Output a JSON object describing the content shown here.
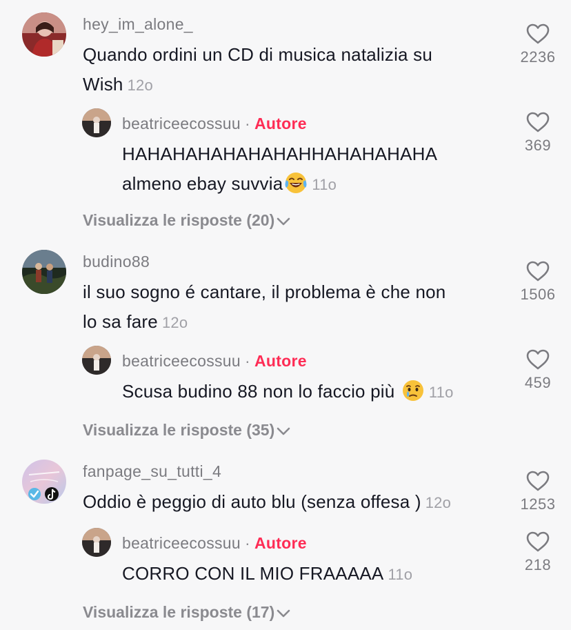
{
  "comments": [
    {
      "username": "hey_im_alone_",
      "text_line1": "Quando ordini un CD di musica natalizia su",
      "text_line2": "Wish",
      "time": "12o",
      "likes": "2236",
      "reply": {
        "username": "beatriceecossuu",
        "separator": "·",
        "badge": "Autore",
        "text_line1": "HAHAHAHAHAHAHAHHAHAHAHAHA",
        "text_line2": "almeno ebay suvvia",
        "emoji": "tears-of-joy-emoji",
        "time": "11o",
        "likes": "369"
      },
      "view_replies": "Visualizza le risposte (20)"
    },
    {
      "username": "budino88",
      "text_line1": "il suo sogno é cantare, il problema è che non",
      "text_line2": "lo sa fare",
      "time": "12o",
      "likes": "1506",
      "reply": {
        "username": "beatriceecossuu",
        "separator": "·",
        "badge": "Autore",
        "text_line1": "Scusa budino 88 non lo faccio più",
        "emoji": "sad-tear-emoji",
        "time": "11o",
        "likes": "459"
      },
      "view_replies": "Visualizza le risposte (35)"
    },
    {
      "username": "fanpage_su_tutti_4",
      "text_line1": "Oddio è peggio di auto blu (senza offesa )",
      "time": "12o",
      "likes": "1253",
      "reply": {
        "username": "beatriceecossuu",
        "separator": "·",
        "badge": "Autore",
        "text_line1": "CORRO CON IL MIO FRAAAAA",
        "time": "11o",
        "likes": "218"
      },
      "view_replies": "Visualizza le risposte (17)"
    }
  ],
  "colors": {
    "background": "#f7f7f8",
    "author_badge": "#fe2c55",
    "text": "#161823",
    "muted": "#7b7b80"
  },
  "icons": {
    "like": "heart-outline-icon",
    "expand": "chevron-down-icon"
  }
}
